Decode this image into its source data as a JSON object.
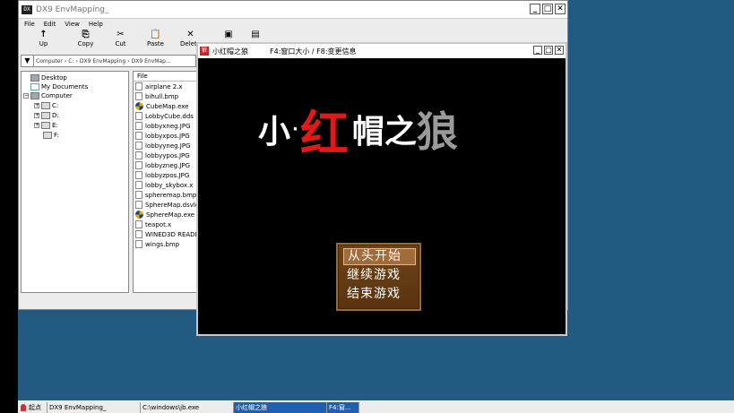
{
  "explorer": {
    "title": "DX9 EnvMapping_",
    "icon_label": "DX",
    "window_buttons": [
      "_",
      "□",
      "✕"
    ],
    "menu": [
      "File",
      "Edit",
      "View",
      "Help"
    ],
    "toolbar": [
      {
        "icon": "↑",
        "label": "Up",
        "name": "up"
      },
      {
        "icon": "⎘",
        "label": "Copy",
        "name": "copy"
      },
      {
        "icon": "✂",
        "label": "Cut",
        "name": "cut"
      },
      {
        "icon": "📋",
        "label": "Paste",
        "name": "paste"
      },
      {
        "icon": "✕",
        "label": "Delete",
        "name": "delete"
      }
    ],
    "address": {
      "arrow": "▼",
      "crumbs": [
        "Computer",
        "C:",
        "DX9 EnvMapping",
        "DX9 EnvMap..."
      ]
    },
    "tree": {
      "desktop": "Desktop",
      "my_documents": "My Documents",
      "computer": "Computer",
      "drives": [
        "C:",
        "D:",
        "E:",
        "F:"
      ]
    },
    "files_header": "File",
    "files": [
      {
        "name": "airplane 2.x",
        "type": "file"
      },
      {
        "name": "bihull.bmp",
        "type": "file"
      },
      {
        "name": "CubeMap.exe",
        "type": "exe"
      },
      {
        "name": "LobbyCube.dds",
        "type": "file"
      },
      {
        "name": "lobbyxneg.JPG",
        "type": "file"
      },
      {
        "name": "lobbyxpos.JPG",
        "type": "file"
      },
      {
        "name": "lobbyyneg.JPG",
        "type": "file"
      },
      {
        "name": "lobbyypos.JPG",
        "type": "file"
      },
      {
        "name": "lobbyzneg.JPG",
        "type": "file"
      },
      {
        "name": "lobbyzpos.JPG",
        "type": "file"
      },
      {
        "name": "lobby_skybox.x",
        "type": "file"
      },
      {
        "name": "spheremap.bmp",
        "type": "file"
      },
      {
        "name": "SphereMap.dsvlc-c",
        "type": "file"
      },
      {
        "name": "SphereMap.exe",
        "type": "exe"
      },
      {
        "name": "teapot.x",
        "type": "file"
      },
      {
        "name": "WINED3D README",
        "type": "file"
      },
      {
        "name": "wings.bmp",
        "type": "file"
      }
    ]
  },
  "game": {
    "title": "小红帽之狼",
    "hint": "F4:窗口大小 / F8:变更信息",
    "icon_label": "狼",
    "window_buttons": [
      "_",
      "□",
      "✕"
    ],
    "logo": {
      "c1": "小",
      "dot": "·",
      "c2": "红",
      "c3": "帽",
      "c4": "之",
      "c5": "狼"
    },
    "menu_options": [
      "从头开始",
      "继续游戏",
      "结束游戏"
    ],
    "selected_index": 0,
    "colors": {
      "logo_red": "#e31818",
      "logo_gray": "#9a9a9a",
      "menu_bg": "#6e4318",
      "menu_border": "#9a6a30"
    }
  },
  "taskbar": {
    "start_label": "起点",
    "tasks": [
      {
        "label": "DX9 EnvMapping_",
        "active": false
      },
      {
        "label": "C:\\windows\\jb.exe",
        "active": false
      },
      {
        "label": "小红帽之狼",
        "active": true
      },
      {
        "label": "F4:窗...",
        "active": true
      }
    ]
  },
  "colors": {
    "desktop": "#235a82",
    "taskbar_active": "#1e5fb0"
  }
}
